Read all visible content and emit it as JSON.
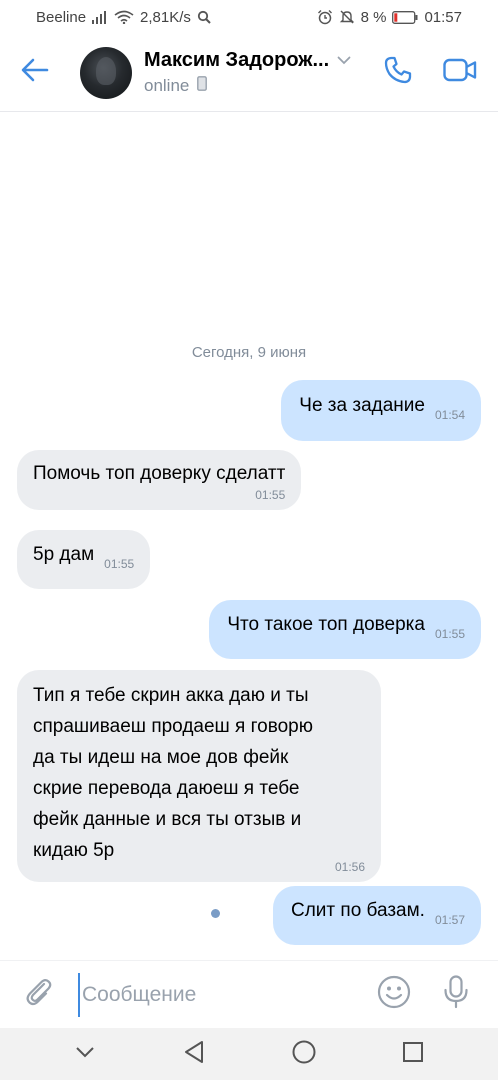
{
  "status_bar": {
    "carrier": "Beeline",
    "speed": "2,81K/s",
    "battery_percent": "8 %",
    "clock": "01:57",
    "icons": [
      "signal-icon",
      "wifi-icon",
      "search-icon",
      "alarm-icon",
      "mute-icon",
      "battery-icon"
    ]
  },
  "header": {
    "contact_name": "Максим Задорож...",
    "status": "online",
    "icons": [
      "back-arrow-icon",
      "chevron-down-icon",
      "mobile-device-icon",
      "phone-icon",
      "video-camera-icon"
    ],
    "accent_color": "#3f8ae0"
  },
  "chat": {
    "date_separator": "Сегодня, 9 июня",
    "messages": [
      {
        "direction": "out",
        "text": "Че за задание",
        "time": "01:54"
      },
      {
        "direction": "in",
        "text": "Помочь топ доверку сделатт",
        "time": "01:55"
      },
      {
        "direction": "in",
        "text": "5р дам",
        "time": "01:55"
      },
      {
        "direction": "out",
        "text": "Что такое топ доверка",
        "time": "01:55"
      },
      {
        "direction": "in",
        "lines": [
          "Тип я тебе скрин акка даю и ты",
          "спрашиваеш продаеш я говорю",
          "да ты идеш на мое дов фейк",
          "скрие перевода даюеш я тебе",
          "фейк данные и вся ты отзыв и",
          "кидаю 5р"
        ],
        "time": "01:56"
      },
      {
        "direction": "out",
        "text": "Слит по базам.",
        "time": "01:57",
        "unread": true
      }
    ],
    "colors": {
      "incoming_bubble": "#ebedf0",
      "outgoing_bubble": "#cce4ff",
      "unread_dot": "#7a9cc6"
    }
  },
  "composer": {
    "placeholder": "Сообщение",
    "value": "",
    "icons": [
      "paperclip-icon",
      "smiley-icon",
      "microphone-icon"
    ]
  },
  "nav_bar": {
    "icons": [
      "chevron-down-icon",
      "back-triangle-icon",
      "home-circle-icon",
      "recent-square-icon"
    ]
  }
}
